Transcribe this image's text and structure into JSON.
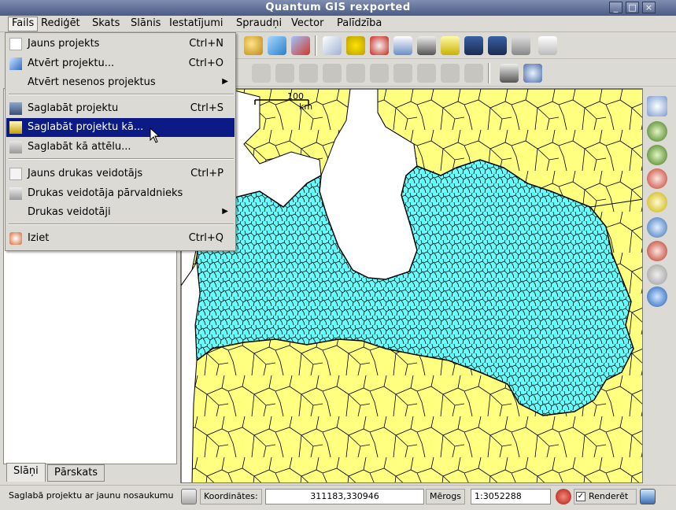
{
  "window": {
    "title": "Quantum GIS rexported",
    "buttons": [
      "_",
      "□",
      "×"
    ]
  },
  "menubar": {
    "items": [
      "Fails",
      "Rediģēt",
      "Skats",
      "Slānis",
      "Iestatījumi",
      "Spraudņi",
      "Vector",
      "Palīdzība"
    ],
    "active": "Fails"
  },
  "file_menu": {
    "items": [
      {
        "label": "Jauns projekts",
        "shortcut": "Ctrl+N",
        "icon": "new-project-icon"
      },
      {
        "label": "Atvērt projektu...",
        "shortcut": "Ctrl+O",
        "icon": "open-project-icon"
      },
      {
        "label": "Atvērt nesenos projektus",
        "submenu_arrow": "▶"
      },
      {
        "label": "Saglabāt projektu",
        "shortcut": "Ctrl+S",
        "icon": "save-project-icon"
      },
      {
        "label": "Saglabāt projektu kā...",
        "icon": "save-project-as-icon",
        "highlighted": true
      },
      {
        "label": "Saglabāt kā attēlu...",
        "icon": "save-as-image-icon"
      },
      {
        "label": "Jauns drukas veidotājs",
        "shortcut": "Ctrl+P",
        "icon": "new-print-composer-icon"
      },
      {
        "label": "Drukas veidotāja pārvaldnieks",
        "icon": "print-composer-manager-icon"
      },
      {
        "label": "Drukas veidotāji",
        "submenu_arrow": "▶"
      },
      {
        "label": "Iziet",
        "shortcut": "Ctrl+Q",
        "icon": "exit-icon"
      }
    ]
  },
  "panel_tabs": [
    "Slāņi",
    "Pārskats"
  ],
  "scalebar": {
    "value": "100",
    "unit": "km"
  },
  "statusbar": {
    "message": "Saglabā projektu ar jaunu nosaukumu",
    "coords_label": "Koordinātes:",
    "coords_value": "311183,330946",
    "scale_label": "Mērogs",
    "scale_value": "1:3052288",
    "render_label": "Renderēt",
    "render_checked": true
  },
  "colors": {
    "land_yellow": "#ffff80",
    "latvia_cyan": "#66ffff",
    "highlight": "#0b1a84",
    "titlebar": "#5a6a94"
  }
}
